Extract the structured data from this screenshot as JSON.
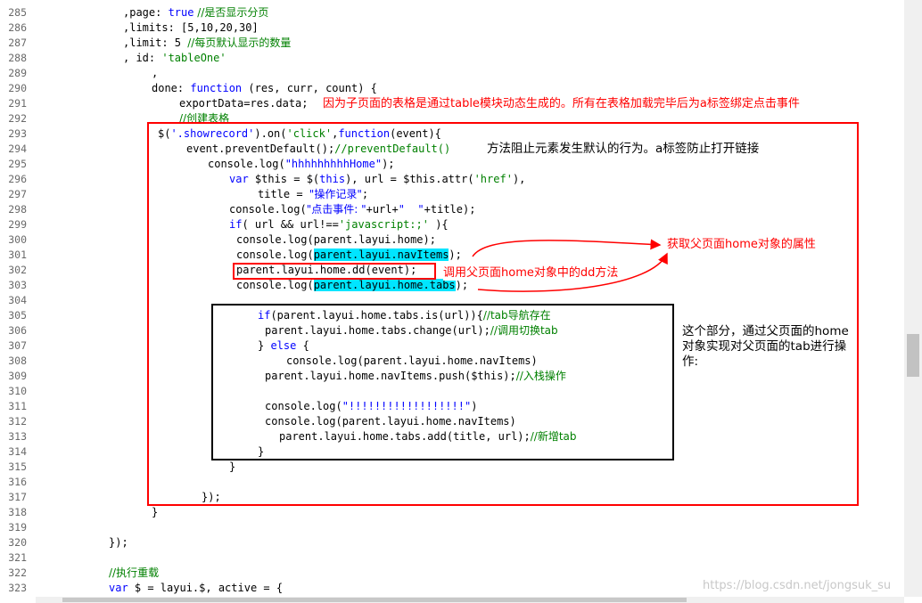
{
  "lines": [
    {
      "n": "285",
      "t": "285"
    },
    {
      "n": "286",
      "t": "286"
    },
    {
      "n": "287",
      "t": "287"
    },
    {
      "n": "288",
      "t": "288"
    },
    {
      "n": "289",
      "t": "289"
    },
    {
      "n": "290",
      "t": "290"
    },
    {
      "n": "291",
      "t": "291"
    },
    {
      "n": "292",
      "t": "292"
    },
    {
      "n": "293",
      "t": "293"
    },
    {
      "n": "294",
      "t": "294"
    },
    {
      "n": "295",
      "t": "295"
    },
    {
      "n": "296",
      "t": "296"
    },
    {
      "n": "297",
      "t": "297"
    },
    {
      "n": "298",
      "t": "298"
    },
    {
      "n": "299",
      "t": "299"
    },
    {
      "n": "300",
      "t": "300"
    },
    {
      "n": "301",
      "t": "301"
    },
    {
      "n": "302",
      "t": "302"
    },
    {
      "n": "303",
      "t": "303"
    },
    {
      "n": "304",
      "t": "304"
    },
    {
      "n": "305",
      "t": "305"
    },
    {
      "n": "306",
      "t": "306"
    },
    {
      "n": "307",
      "t": "307"
    },
    {
      "n": "308",
      "t": "308"
    },
    {
      "n": "309",
      "t": "309"
    },
    {
      "n": "310",
      "t": "310"
    },
    {
      "n": "311",
      "t": "311"
    },
    {
      "n": "312",
      "t": "312"
    },
    {
      "n": "313",
      "t": "313"
    },
    {
      "n": "314",
      "t": "314"
    },
    {
      "n": "315",
      "t": "315"
    },
    {
      "n": "316",
      "t": "316"
    },
    {
      "n": "317",
      "t": "317"
    },
    {
      "n": "318",
      "t": "318"
    },
    {
      "n": "319",
      "t": "319"
    },
    {
      "n": "320",
      "t": "320"
    },
    {
      "n": "321",
      "t": "321"
    },
    {
      "n": "322",
      "t": "322"
    },
    {
      "n": "323",
      "t": "323"
    }
  ],
  "code": {
    "l285a": ",page: ",
    "l285b": "true",
    "l285c": " //是否显示分页",
    "l286": ",limits: [5,10,20,30]",
    "l287a": ",limit: 5 ",
    "l287b": "//每页默认显示的数量",
    "l288a": ", id: ",
    "l288b": "'tableOne'",
    "l289": ",",
    "l290a": "done: ",
    "l290b": "function",
    "l290c": " (res, curr, count) {",
    "l291": "exportData=res.data;",
    "l292": "//创建表格",
    "l293a": "$(",
    "l293b": "'.showrecord'",
    "l293c": ").on(",
    "l293d": "'click'",
    "l293e": ",",
    "l293f": "function",
    "l293g": "(event){",
    "l294a": "event.preventDefault();",
    "l294b": "//preventDefault()",
    "l295a": "console.log(",
    "l295b": "\"hhhhhhhhhHome\"",
    "l295c": ");",
    "l296a": "var",
    "l296b": " $this = $(",
    "l296c": "this",
    "l296d": "), url = $this.attr(",
    "l296e": "'href'",
    "l296f": "),",
    "l297a": "title = ",
    "l297b": "\"操作记录\"",
    "l297c": ";",
    "l298a": "console.log(",
    "l298b": "\"点击事件: \"",
    "l298c": "+url+",
    "l298d": "\"  \"",
    "l298e": "+title);",
    "l299a": "if",
    "l299b": "( url && url!==",
    "l299c": "'javascript:;'",
    "l299d": " ){",
    "l300": "console.log(parent.layui.home);",
    "l301a": "console.log(",
    "l301b": "parent.layui.navItems",
    "l301c": ");",
    "l302": "parent.layui.home.dd(event);",
    "l303a": "console.log(",
    "l303b": "parent.layui.home.tabs",
    "l303c": ");",
    "l305a": "if",
    "l305b": "(parent.layui.home.tabs.is(url)){",
    "l305c": "//tab导航存在",
    "l306a": "parent.layui.home.tabs.change(url);",
    "l306b": "//调用切换tab",
    "l307a": "} ",
    "l307b": "else",
    "l307c": " {",
    "l308": "console.log(parent.layui.home.navItems)",
    "l309a": "parent.layui.home.navItems.push($this);",
    "l309b": "//入栈操作",
    "l311a": "console.log(",
    "l311b": "\"!!!!!!!!!!!!!!!!!!\"",
    "l311c": ")",
    "l312": "console.log(parent.layui.home.navItems)",
    "l313a": "parent.layui.home.tabs.add(title, url);",
    "l313b": "//新增tab",
    "l314": "}",
    "l315": "}",
    "l317": "});",
    "l318": "}",
    "l320": "});",
    "l322": "//执行重载",
    "l323a": "var",
    "l323b": " $ = layui.$, active = {"
  },
  "annotations": {
    "a1": "因为子页面的表格是通过table模块动态生成的。所有在表格加载完毕后为a标签绑定点击事件",
    "a2": "方法阻止元素发生默认的行为。a标签防止打开链接",
    "a3": "获取父页面home对象的属性",
    "a4": "调用父页面home对象中的dd方法",
    "a5": "这个部分，通过父页面的home对象实现对父页面的tab进行操作:"
  },
  "watermark": "https://blog.csdn.net/jongsuk_su",
  "colors": {
    "keyword": "#0000ff",
    "comment": "#008000",
    "annotation": "#ff0000",
    "highlight": "#00e5ff"
  }
}
